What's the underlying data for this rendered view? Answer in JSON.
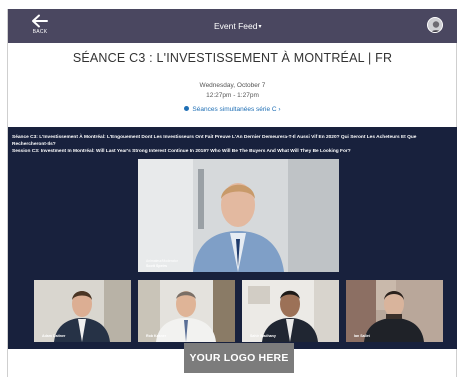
{
  "header": {
    "back_label": "BACK",
    "feed_label": "Event Feed",
    "feed_caret": "▾"
  },
  "event": {
    "title": "SÉANCE C3 : L'INVESTISSEMENT À MONTRÉAL | FR",
    "date": "Wednesday, October 7",
    "time": "12:27pm - 1:27pm",
    "sessions_link": "Séances simultanées série C",
    "sessions_link_suffix": "›"
  },
  "video": {
    "caption_line1": "Séance C3: L'Investissement À Montréal: L'Engouement Dont Les Investisseurs Ont Fait Preuve L'An Dernier Demeurera-T-Il Aussi Vif En 2020? Qui Seront Les Acheteurs Et Que Rechercheront-Ils?",
    "caption_line2": "Session C3: Investment In Montréal: Will Last Year's Strong Interest Continue In 2019? Who Will Be The Buyers And What Will They Be Looking For?",
    "main_speaker": {
      "role": "Animateur/Moderator",
      "name": "Scott Speirs"
    },
    "panelists": [
      {
        "name": "Adam Daitner"
      },
      {
        "name": "Rob Kasner"
      },
      {
        "name": "Sahir Wadhany"
      },
      {
        "name": "Ian Sallet"
      }
    ]
  },
  "footer": {
    "logo_text": "YOUR LOGO HERE"
  },
  "colors": {
    "header_bg": "#4a4760",
    "video_bg": "#18213d",
    "link": "#1f6fb5",
    "logo_bg": "#7c7c7c"
  },
  "icons": {
    "back": "arrow-left-icon",
    "caret": "caret-down-icon",
    "link_dot": "dot-icon",
    "link_chevron": "chevron-right-icon"
  }
}
